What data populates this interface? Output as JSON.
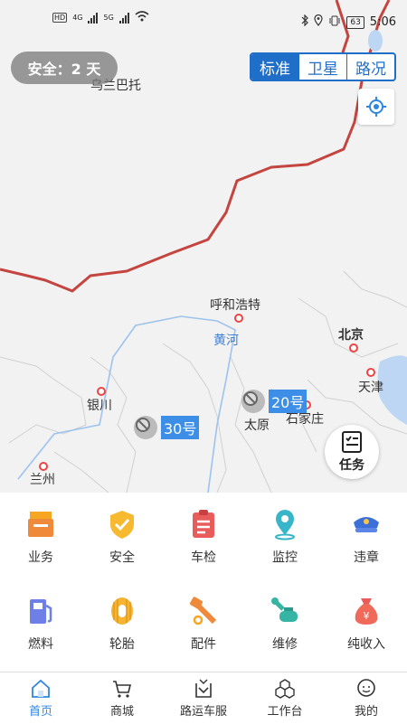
{
  "status_bar": {
    "time": "5:06",
    "battery": "63",
    "network_4g": "4G",
    "network_5g": "5G",
    "hd": "HD"
  },
  "map": {
    "safety_badge": "安全：2 天",
    "map_modes": [
      "标准",
      "卫星",
      "路况"
    ],
    "cities": [
      {
        "name": "乌兰巴托"
      },
      {
        "name": "呼和浩特"
      },
      {
        "name": "北京"
      },
      {
        "name": "天津"
      },
      {
        "name": "银川"
      },
      {
        "name": "太原"
      },
      {
        "name": "石家庄"
      },
      {
        "name": "兰州"
      }
    ],
    "river": "黄河",
    "vehicles": [
      {
        "label": "20号"
      },
      {
        "label": "30号"
      }
    ],
    "task_button": "任务"
  },
  "features": [
    {
      "label": "业务",
      "icon": "business-icon",
      "color": "#f5a623"
    },
    {
      "label": "安全",
      "icon": "shield-check-icon",
      "color": "#f6b930"
    },
    {
      "label": "车检",
      "icon": "clipboard-check-icon",
      "color": "#e85c5c"
    },
    {
      "label": "监控",
      "icon": "location-pin-icon",
      "color": "#38b6c9"
    },
    {
      "label": "违章",
      "icon": "police-cap-icon",
      "color": "#3d6fd8"
    },
    {
      "label": "燃料",
      "icon": "fuel-pump-icon",
      "color": "#6f7fe8"
    },
    {
      "label": "轮胎",
      "icon": "tire-icon",
      "color": "#f5b433"
    },
    {
      "label": "配件",
      "icon": "bolt-icon",
      "color": "#f08a3b"
    },
    {
      "label": "维修",
      "icon": "wrench-icon",
      "color": "#37b5a4"
    },
    {
      "label": "纯收入",
      "icon": "money-bag-icon",
      "color": "#f06a5a"
    }
  ],
  "tabs": [
    {
      "label": "首页",
      "icon": "home-icon",
      "active": true
    },
    {
      "label": "商城",
      "icon": "cart-icon",
      "active": false
    },
    {
      "label": "路运车服",
      "icon": "vehicle-service-icon",
      "active": false
    },
    {
      "label": "工作台",
      "icon": "workbench-icon",
      "active": false
    },
    {
      "label": "我的",
      "icon": "user-icon",
      "active": false
    }
  ],
  "colors": {
    "accent": "#1f6fc9",
    "tab_active": "#2f86e0",
    "border_line": "#c4443f"
  }
}
